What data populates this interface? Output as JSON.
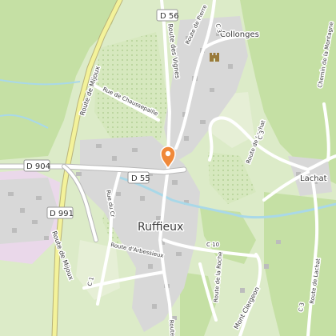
{
  "map": {
    "colors": {
      "forest": "#c5e0a4",
      "meadow": "#dcebc8",
      "field": "#e6efd6",
      "urban": "#d8d8d8",
      "building": "#bcbcbc",
      "main_road": "#f3f29a",
      "main_road_casing": "#b8b27a",
      "local_road": "#ffffff",
      "river": "#a9d8e8",
      "marker": "#f0893a",
      "industrial": "#ead8ea"
    },
    "place_labels": {
      "village_main": "Ruffieux",
      "hamlet_collonges": "Collonges",
      "hamlet_lachat": "Lachat"
    },
    "road_labels": {
      "route_de_mijoux_north": "Route de Mijoux",
      "route_des_vignes": "Route des Vignes",
      "route_de_pierre": "Route de Pierre",
      "rue_de_chaussepaille": "Rue de Chaussepaille",
      "route_de_lachat_mid": "Route de Lachat",
      "chemin_de_la_montagne": "Chemin de la Montagne",
      "rue_du_cr": "Rue du Cr",
      "route_d_arbessieux": "Route d'Arbessieux",
      "route_de_mijoux_south": "Route de Mijoux",
      "route_de_la_roche": "Route de la Roche",
      "mont_clergeon": "Mont Clergeon",
      "route_de_lachat_south": "Route de Lachat",
      "route_south": "Route"
    },
    "shields": {
      "d56": "D 56",
      "d904": "D 904",
      "d991": "D 991",
      "d55": "D 55"
    },
    "small_refs": {
      "c3_north": "C 3",
      "c3_east": "C 3",
      "c3_south": "C 3",
      "c10": "C 10",
      "c1": "C 1"
    },
    "icons": {
      "location_marker": "location-pin-icon",
      "castle": "castle-icon"
    }
  }
}
